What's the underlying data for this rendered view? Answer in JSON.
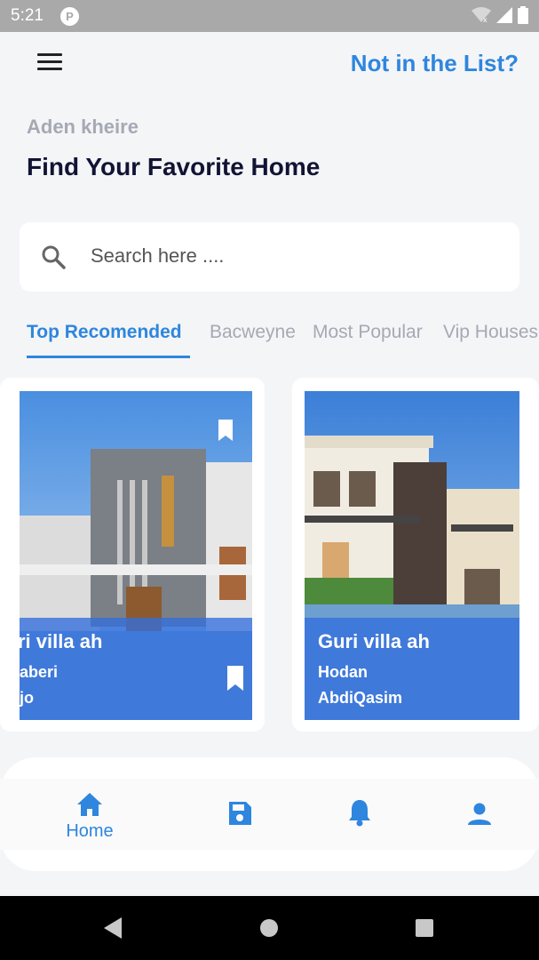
{
  "status_bar": {
    "time": "5:21",
    "app_icon_letter": "P"
  },
  "header": {
    "menu_icon": "hamburger-menu-icon",
    "action_label": "Not in the List?"
  },
  "greeting": {
    "user_name": "Aden kheire",
    "title": "Find Your Favorite Home"
  },
  "search": {
    "placeholder": "Search here ...."
  },
  "tabs": [
    {
      "label": "Top Recomended",
      "active": true
    },
    {
      "label": "Bacweyne",
      "active": false
    },
    {
      "label": "Most Popular",
      "active": false
    },
    {
      "label": "Vip Houses",
      "active": false
    }
  ],
  "cards": [
    {
      "title": "ri villa ah",
      "line1": "aberi",
      "line2": "jo"
    },
    {
      "title": "Guri villa ah",
      "line1": "Hodan",
      "line2": "AbdiQasim"
    }
  ],
  "bottom_nav": [
    {
      "icon": "home-icon",
      "label": "Home",
      "active": true
    },
    {
      "icon": "save-icon",
      "label": "",
      "active": false
    },
    {
      "icon": "bell-icon",
      "label": "",
      "active": false
    },
    {
      "icon": "person-icon",
      "label": "",
      "active": false
    }
  ],
  "colors": {
    "accent": "#2e86de",
    "title": "#111433",
    "muted": "#a5a9b4",
    "overlay": "#326edc"
  }
}
